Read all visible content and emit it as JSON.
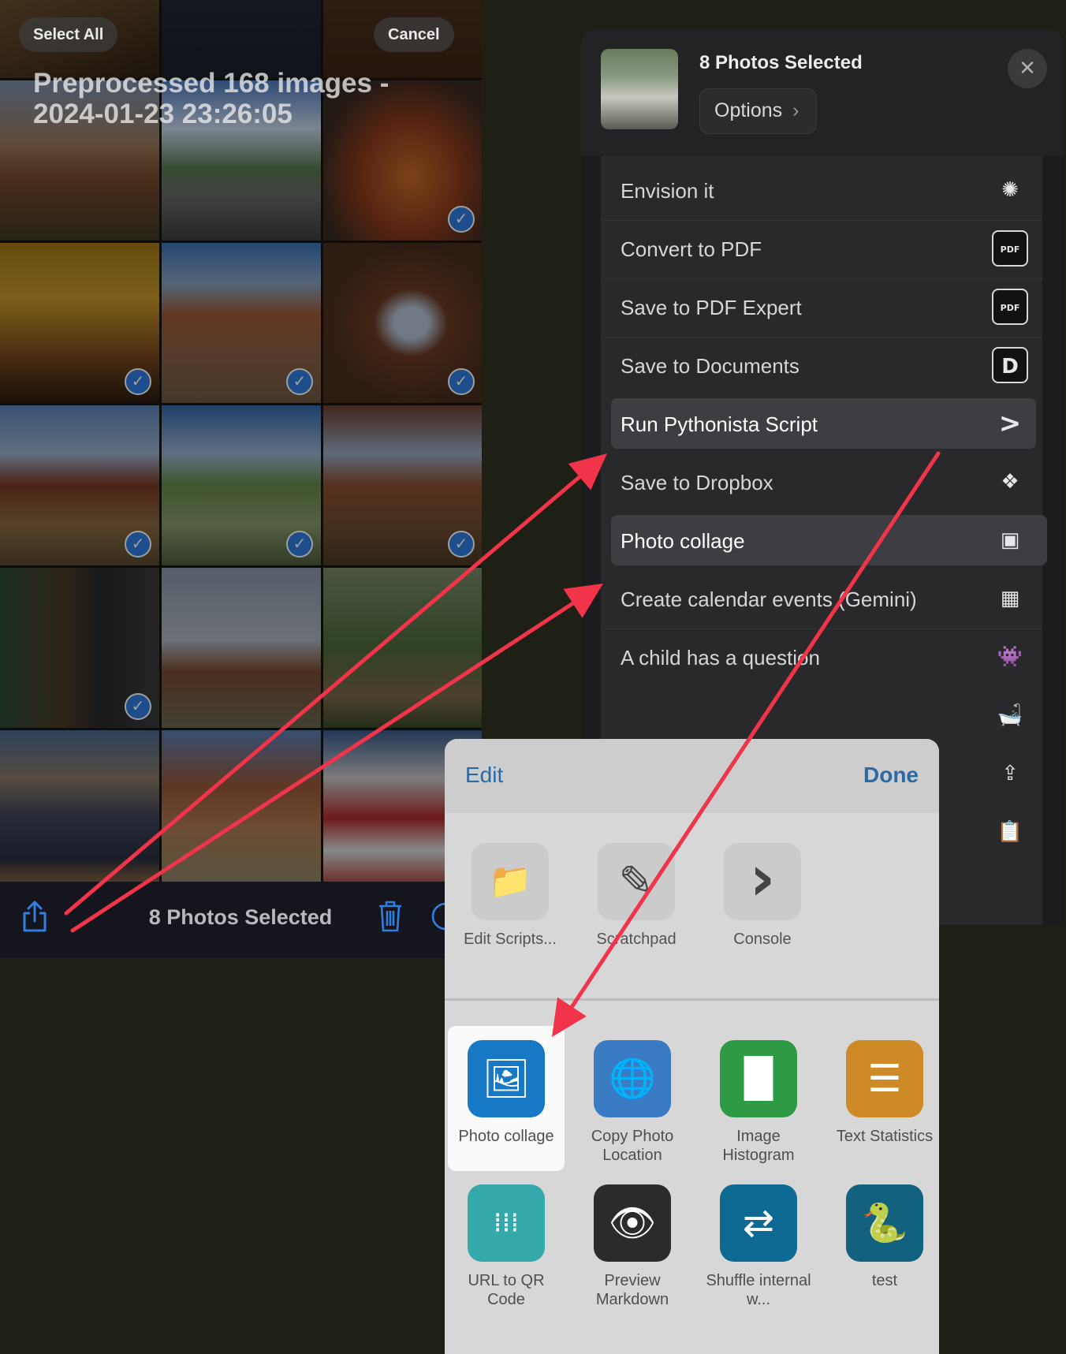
{
  "photos_app": {
    "select_all": "Select All",
    "cancel": "Cancel",
    "album_title": "Preprocessed 168 images - 2024-01-23 23:26:05",
    "selected_count": "8 Photos Selected",
    "checkmark": "✓",
    "share_icon": "share-icon",
    "trash_icon": "trash-icon"
  },
  "share_sheet": {
    "title": "8 Photos Selected",
    "options": "Options",
    "options_chevron": "›",
    "close": "✕",
    "actions": [
      {
        "label": "Envision it",
        "icon": "sparkle-icon",
        "glyph": "✺"
      },
      {
        "label": "Convert to PDF",
        "icon": "pdf-expert-icon",
        "glyph": "PDF"
      },
      {
        "label": "Save to PDF Expert",
        "icon": "pdf-expert-icon",
        "glyph": "PDF"
      },
      {
        "label": "Save to Documents",
        "icon": "documents-icon",
        "glyph": "D"
      },
      {
        "label": "Run Pythonista Script",
        "icon": "pythonista-icon",
        "glyph": ">"
      },
      {
        "label": "Save to Dropbox",
        "icon": "dropbox-icon",
        "glyph": "❖"
      },
      {
        "label": "Photo collage",
        "icon": "photo-collage-icon",
        "glyph": "▣"
      },
      {
        "label": "Create calendar events (Gemini)",
        "icon": "calendar-add-icon",
        "glyph": "▦"
      },
      {
        "label": "A child has a question",
        "icon": "space-invader-icon",
        "glyph": "👾"
      },
      {
        "label": "",
        "icon": "bathtub-icon",
        "glyph": "🛁"
      },
      {
        "label": "",
        "icon": "share-upload-icon",
        "glyph": "⇪"
      },
      {
        "label": "",
        "icon": "clipboard-icon",
        "glyph": "📋"
      }
    ]
  },
  "pythonista": {
    "edit": "Edit",
    "done": "Done",
    "tools": [
      {
        "label": "Edit Scripts...",
        "icon": "folder-icon",
        "glyph": "📁"
      },
      {
        "label": "Scratchpad",
        "icon": "compose-icon",
        "glyph": "✎"
      },
      {
        "label": "Console",
        "icon": "console-icon",
        "glyph": "›"
      }
    ],
    "scripts": [
      {
        "label": "Photo collage",
        "icon": "photo-collage-icon",
        "glyph": "🖼",
        "color": "#1779c5"
      },
      {
        "label": "Copy Photo Location",
        "icon": "globe-icon",
        "glyph": "🌐",
        "color": "#3a7cc4"
      },
      {
        "label": "Image Histogram",
        "icon": "histogram-icon",
        "glyph": "▐▌",
        "color": "#2e9a46"
      },
      {
        "label": "Text Statistics",
        "icon": "document-icon",
        "glyph": "☰",
        "color": "#cf8a28"
      },
      {
        "label": "URL to QR Code",
        "icon": "grid-icon",
        "glyph": "⁞⁞⁞",
        "color": "#34a9ab"
      },
      {
        "label": "Preview Markdown",
        "icon": "eye-icon",
        "glyph": "👁",
        "color": "#2b2b2b"
      },
      {
        "label": "Shuffle internal w...",
        "icon": "shuffle-icon",
        "glyph": "⇄",
        "color": "#0f6a93"
      },
      {
        "label": "test",
        "icon": "python-icon",
        "glyph": "🐍",
        "color": "#11617f"
      }
    ]
  },
  "colors": {
    "arrow": "#f2344a",
    "accent_blue": "#2f7ee0",
    "link_blue": "#2a6aa5"
  }
}
